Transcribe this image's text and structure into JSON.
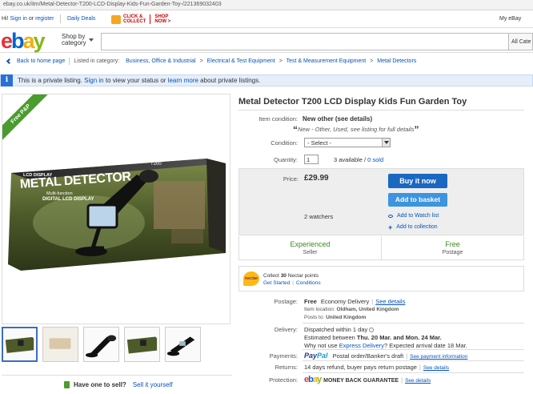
{
  "url": "ebay.co.uk/itm/Metal-Detector-T200-LCD-Display-Kids-Fun-Garden-Toy-/221369032403",
  "header": {
    "hi": "Hi!",
    "sign_in": "Sign in",
    "or": "or",
    "register": "register",
    "daily_deals": "Daily Deals",
    "promo_1": "CLICK &",
    "promo_2": "COLLECT",
    "promo_3": "SHOP",
    "promo_4": "NOW >",
    "my_ebay": "My eBay",
    "shop_by_1": "Shop by",
    "shop_by_2": "category",
    "all_categories": "All Cate"
  },
  "logo": {
    "e": "e",
    "b": "b",
    "a": "a",
    "y": "y"
  },
  "breadcrumb": {
    "back": "Back to home page",
    "listed_in": "Listed in category:",
    "items": [
      "Business, Office & Industrial",
      "Electrical & Test Equipment",
      "Test & Measurement Equipment",
      "Metal Detectors"
    ]
  },
  "notice": {
    "text_1": "This is a private listing.",
    "sign_in": "Sign in",
    "text_2": "to view your status or",
    "learn_more": "learn more",
    "text_3": "about private listings."
  },
  "ribbon": "Free P&P",
  "product": {
    "box_title": "METAL DETECTOR",
    "box_top": "LCD DISPLAY",
    "box_model": "T200",
    "box_sub": "Multi-function",
    "box_sub2": "DIGITAL LCD DISPLAY"
  },
  "item": {
    "title": "Metal Detector T200 LCD Display Kids Fun Garden Toy",
    "condition_label": "Item condition:",
    "condition_value": "New other (see details)",
    "condition_sub": "New - Other, Used, see listing for full details",
    "condition_select_label": "Condition:",
    "condition_select_value": "- Select -",
    "quantity_label": "Quantity:",
    "quantity_value": "1",
    "available": "3 available",
    "sold": "0 sold",
    "price_label": "Price:",
    "price": "£29.99",
    "buy_now": "Buy it now",
    "add_basket": "Add to basket",
    "watchers": "2 watchers",
    "watch_list": "Add to Watch list",
    "add_collection": "Add to collection",
    "seller_badge": "Experienced",
    "seller_sub": "Seller",
    "postage_badge": "Free",
    "postage_sub": "Postage"
  },
  "nectar": {
    "logo": "nectar",
    "collect_1": "Collect",
    "collect_points": "30",
    "collect_2": "Nectar points",
    "get_started": "Get Started",
    "conditions": "Conditions"
  },
  "details": {
    "postage_label": "Postage:",
    "postage_value": "Free",
    "postage_type": "Economy Delivery",
    "see_details": "See details",
    "location_label": "Item location:",
    "location_value": "Oldham, United Kingdom",
    "posts_label": "Posts to:",
    "posts_value": "United Kingdom",
    "delivery_label": "Delivery:",
    "delivery_1": "Dispatched within 1 day",
    "delivery_2a": "Estimated between",
    "delivery_2b": "Thu. 20 Mar. and Mon. 24 Mar.",
    "delivery_3a": "Why not use",
    "delivery_3b": "Express Delivery",
    "delivery_3c": "? Expected arrival date 18 Mar.",
    "payments_label": "Payments:",
    "paypal_1": "Pay",
    "paypal_2": "Pal",
    "payments_value": "Postal order/Banker's draft",
    "see_payment": "See payment information",
    "returns_label": "Returns:",
    "returns_value": "14 days refund, buyer pays return postage",
    "protection_label": "Protection:",
    "mbg": "MONEY BACK GUARANTEE"
  },
  "sell": {
    "have_one": "Have one to sell?",
    "sell_it": "Sell it yourself"
  }
}
